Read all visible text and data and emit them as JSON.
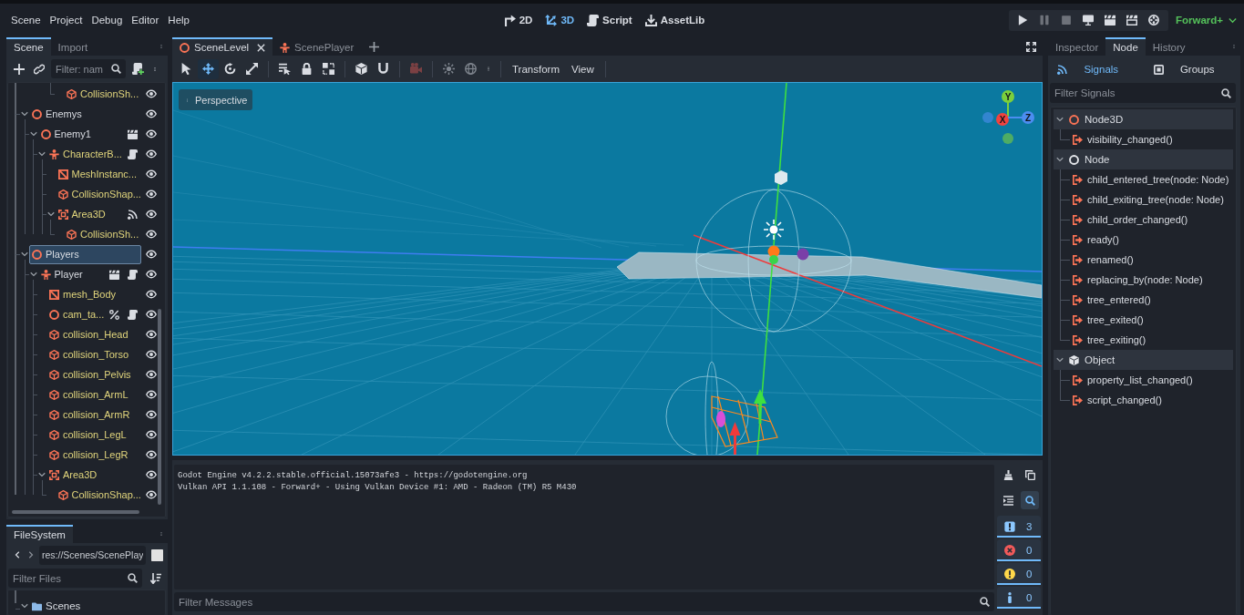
{
  "menu_bar": {
    "menus": [
      "Scene",
      "Project",
      "Debug",
      "Editor",
      "Help"
    ],
    "workspaces": [
      {
        "kind": "canvas",
        "label": "2D",
        "selected": false
      },
      {
        "kind": "spatial",
        "label": "3D",
        "selected": true
      },
      {
        "kind": "script",
        "label": "Script",
        "selected": false
      },
      {
        "kind": "assetlib",
        "label": "AssetLib",
        "selected": false
      }
    ],
    "run_buttons": [
      {
        "kind": "play",
        "disabled": false
      },
      {
        "kind": "pause",
        "disabled": true
      },
      {
        "kind": "stop",
        "disabled": true
      },
      {
        "kind": "remote",
        "disabled": false
      },
      {
        "kind": "play_scene",
        "disabled": false
      },
      {
        "kind": "play_custom",
        "disabled": false
      },
      {
        "kind": "movie",
        "disabled": false
      }
    ],
    "renderer": "Forward+"
  },
  "scene_dock": {
    "tabs": [
      {
        "label": "Scene",
        "selected": true
      },
      {
        "label": "Import",
        "selected": false
      }
    ],
    "filter": {
      "placeholder": "Filter: nam"
    },
    "tree": [
      {
        "children": [
          {
            "children": [
              {
                "children": [
                  {
                    "children": [
                      {
                        "name": "CollisionSh...",
                        "kind": "collision_shape",
                        "instanced_child": true,
                        "visible": true,
                        "selected": false
                      }
                    ]
                  }
                ]
              }
            ]
          }
        ]
      },
      {
        "name": "Enemys",
        "kind": "node3d",
        "instanced_child": false,
        "visible": true,
        "selected": false,
        "expanded": true,
        "children": [
          {
            "name": "Enemy1",
            "kind": "node3d",
            "instanced_child": false,
            "badges": [
              {
                "kind": "instance"
              }
            ],
            "visible": true,
            "selected": false,
            "expanded": true,
            "children": [
              {
                "name": "CharacterB...",
                "kind": "character_body",
                "instanced_child": true,
                "badges": [
                  {
                    "kind": "script"
                  }
                ],
                "visible": true,
                "selected": false,
                "expanded": true,
                "children": [
                  {
                    "name": "MeshInstanc...",
                    "kind": "mesh_instance",
                    "instanced_child": true,
                    "visible": true,
                    "selected": false
                  },
                  {
                    "name": "CollisionShap...",
                    "kind": "collision_shape",
                    "instanced_child": true,
                    "visible": true,
                    "selected": false
                  },
                  {
                    "name": "Area3D",
                    "kind": "area",
                    "instanced_child": true,
                    "badges": [
                      {
                        "kind": "signals"
                      }
                    ],
                    "visible": true,
                    "selected": false,
                    "expanded": true,
                    "children": [
                      {
                        "name": "CollisionSh...",
                        "kind": "collision_shape",
                        "instanced_child": true,
                        "visible": true,
                        "selected": false
                      }
                    ]
                  }
                ]
              }
            ]
          }
        ]
      },
      {
        "name": "Players",
        "kind": "node3d",
        "instanced_child": false,
        "visible": true,
        "selected": true,
        "expanded": true,
        "children": [
          {
            "name": "Player",
            "kind": "character_body",
            "instanced_child": false,
            "badges": [
              {
                "kind": "instance"
              },
              {
                "kind": "script"
              }
            ],
            "visible": true,
            "selected": false,
            "expanded": true,
            "children": [
              {
                "name": "mesh_Body",
                "kind": "mesh_instance",
                "instanced_child": true,
                "visible": true,
                "selected": false
              },
              {
                "name": "cam_ta...",
                "kind": "node3d",
                "instanced_child": true,
                "badges": [
                  {
                    "kind": "unique"
                  },
                  {
                    "kind": "script"
                  }
                ],
                "visible": true,
                "selected": false
              },
              {
                "name": "collision_Head",
                "kind": "collision_shape",
                "instanced_child": true,
                "visible": true,
                "selected": false
              },
              {
                "name": "collision_Torso",
                "kind": "collision_shape",
                "instanced_child": true,
                "visible": true,
                "selected": false
              },
              {
                "name": "collision_Pelvis",
                "kind": "collision_shape",
                "instanced_child": true,
                "visible": true,
                "selected": false
              },
              {
                "name": "collision_ArmL",
                "kind": "collision_shape",
                "instanced_child": true,
                "visible": true,
                "selected": false
              },
              {
                "name": "collision_ArmR",
                "kind": "collision_shape",
                "instanced_child": true,
                "visible": true,
                "selected": false
              },
              {
                "name": "collision_LegL",
                "kind": "collision_shape",
                "instanced_child": true,
                "visible": true,
                "selected": false
              },
              {
                "name": "collision_LegR",
                "kind": "collision_shape",
                "instanced_child": true,
                "visible": true,
                "selected": false
              },
              {
                "name": "Area3D",
                "kind": "area",
                "instanced_child": true,
                "visible": true,
                "selected": false,
                "expanded": true,
                "children": [
                  {
                    "name": "CollisionShap...",
                    "kind": "collision_shape",
                    "instanced_child": true,
                    "visible": true,
                    "selected": false
                  }
                ]
              }
            ]
          }
        ]
      }
    ]
  },
  "filesystem_dock": {
    "tabs": [
      {
        "label": "FileSystem",
        "selected": true
      }
    ],
    "path": "res://Scenes/ScenePlay",
    "filter": {
      "placeholder": "Filter Files"
    },
    "tree": [
      {
        "name": "Scenes",
        "kind": "folder",
        "expanded": true,
        "selected": false
      }
    ]
  },
  "scene_tabs": [
    {
      "label": "SceneLevel",
      "kind": "node3d",
      "selected": true
    },
    {
      "label": "ScenePlayer",
      "kind": "character_body",
      "selected": false
    }
  ],
  "viewport_toolbar": {
    "tools": [
      {
        "kind": "select",
        "selected": false
      },
      {
        "kind": "move",
        "selected": true
      },
      {
        "kind": "rotate",
        "selected": false
      },
      {
        "kind": "scale",
        "selected": false
      }
    ],
    "actions": [
      {
        "kind": "list_select"
      },
      {
        "kind": "lock"
      },
      {
        "kind": "group"
      }
    ],
    "toggles": [
      {
        "kind": "local_space"
      },
      {
        "kind": "snap"
      }
    ],
    "preview": [
      {
        "kind": "camera_preview",
        "disabled": true
      }
    ],
    "environment": [
      {
        "kind": "sun",
        "on": false
      },
      {
        "kind": "environment",
        "on": false
      }
    ],
    "menus": [
      "Transform",
      "View"
    ]
  },
  "viewport": {
    "view_menu": "Perspective",
    "gizmo": [
      {
        "label": "Y",
        "color": "#7ccf3c"
      },
      {
        "label": "X",
        "color": "#f0433f"
      },
      {
        "label": "Z",
        "color": "#4c8df0"
      }
    ]
  },
  "output": {
    "lines": [
      "Godot Engine v4.2.2.stable.official.15073afe3 - https://godotengine.org",
      "Vulkan API 1.1.108 - Forward+ - Using Vulkan Device #1: AMD - Radeon (TM) R5 M430"
    ],
    "filter": {
      "placeholder": "Filter Messages"
    },
    "search_on": true,
    "message_filters": [
      {
        "kind": "message",
        "count": "3",
        "on": true
      },
      {
        "kind": "error",
        "count": "0",
        "on": true
      },
      {
        "kind": "warning",
        "count": "0",
        "on": true
      },
      {
        "kind": "editor",
        "count": "0",
        "on": true
      }
    ]
  },
  "node_dock": {
    "tabs": [
      {
        "label": "Inspector",
        "selected": false
      },
      {
        "label": "Node",
        "selected": true
      },
      {
        "label": "History",
        "selected": false
      }
    ],
    "modes": [
      {
        "kind": "signals",
        "label": "Signals",
        "selected": true
      },
      {
        "kind": "groups",
        "label": "Groups",
        "selected": false
      }
    ],
    "filter": {
      "placeholder": "Filter Signals"
    },
    "classes": [
      {
        "name": "Node3D",
        "kind": "node3d",
        "expanded": true,
        "signals": [
          "visibility_changed()"
        ]
      },
      {
        "name": "Node",
        "kind": "node",
        "expanded": true,
        "signals": [
          "child_entered_tree(node: Node)",
          "child_exiting_tree(node: Node)",
          "child_order_changed()",
          "ready()",
          "renamed()",
          "replacing_by(node: Node)",
          "tree_entered()",
          "tree_exited()",
          "tree_exiting()"
        ]
      },
      {
        "name": "Object",
        "kind": "object",
        "expanded": true,
        "signals": [
          "property_list_changed()",
          "script_changed()"
        ]
      }
    ]
  }
}
